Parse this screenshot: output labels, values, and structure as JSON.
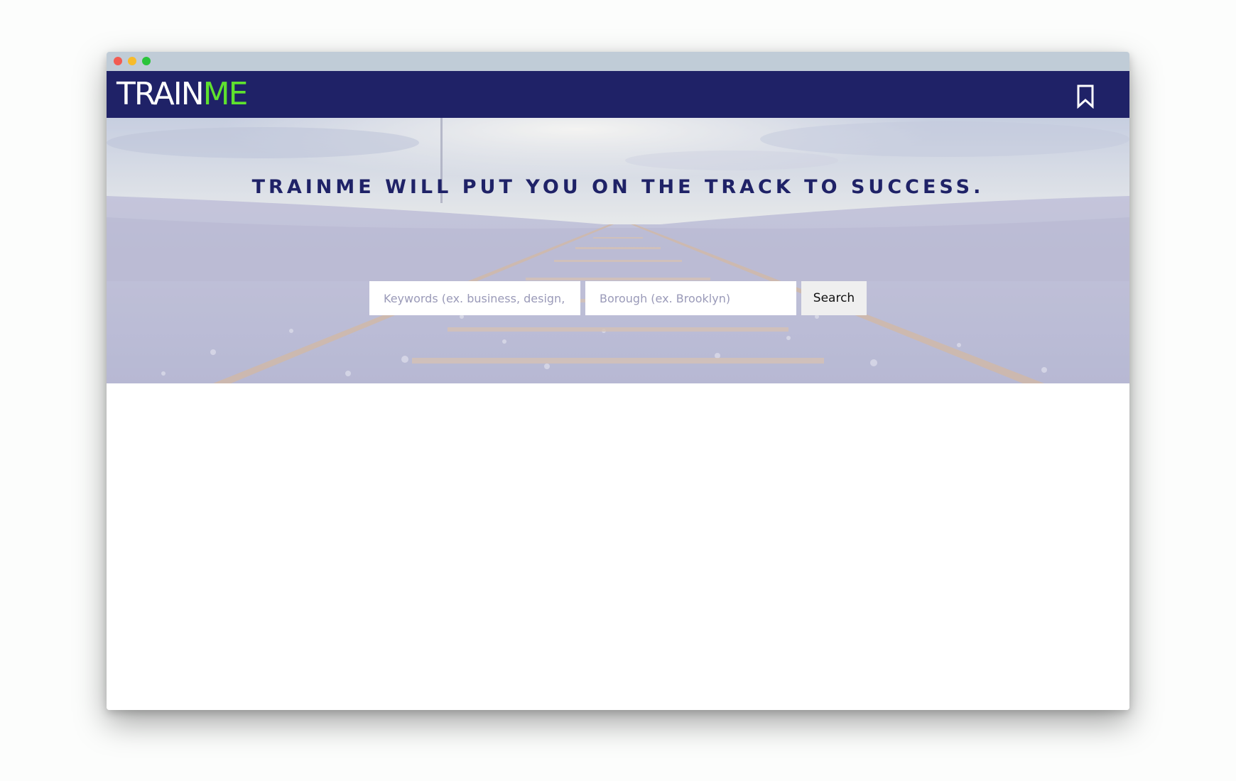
{
  "brand": {
    "logo_part1": "TRAIN",
    "logo_part2": "ME",
    "nav_color": "#1f2267",
    "accent_color": "#5fe22e"
  },
  "header": {
    "bookmark_icon": "bookmark-icon"
  },
  "hero": {
    "tagline": "TRAINME WILL PUT YOU ON THE TRACK TO SUCCESS.",
    "background": "railway-tracks-photo"
  },
  "search": {
    "keywords_placeholder": "Keywords (ex. business, design, he",
    "borough_placeholder": "Borough (ex. Brooklyn)",
    "button_label": "Search"
  }
}
